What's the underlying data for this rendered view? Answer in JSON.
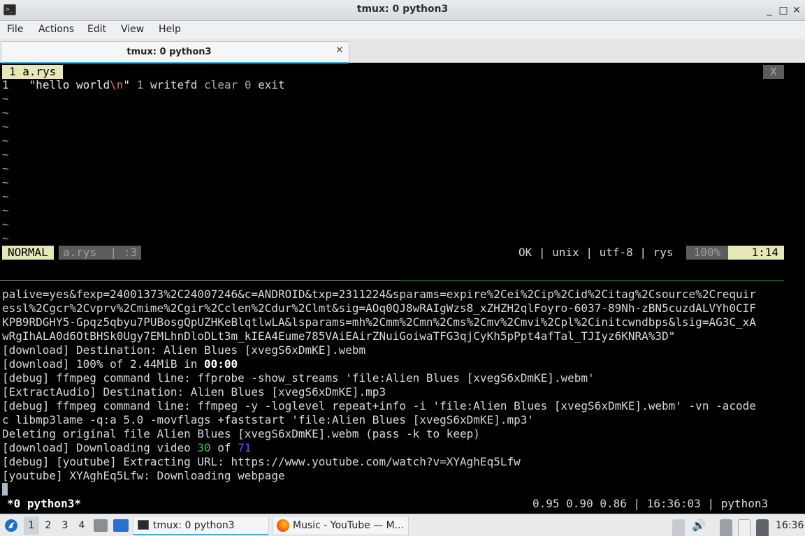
{
  "window": {
    "title": "tmux: 0 python3",
    "controls": {
      "minimize": "_",
      "maximize": "□",
      "close": "✕"
    }
  },
  "menu": [
    "File",
    "Actions",
    "Edit",
    "View",
    "Help"
  ],
  "tab": {
    "label": "tmux: 0 python3",
    "close": "✕"
  },
  "vim": {
    "tabline": {
      "active": "1 a.rys",
      "close": "X"
    },
    "line_number": "1",
    "code": {
      "str_open": "\"hello world",
      "esc": "\\n",
      "str_close": "\"",
      "num1": "1",
      "fn1": "writefd",
      "kw1": "clear",
      "num2": "0",
      "fn2": "exit"
    },
    "tilde": "~",
    "status": {
      "mode": "NORMAL",
      "file": "a.rys  | :3",
      "info": "OK | unix | utf-8 | rys",
      "percent": "100%",
      "position": "1:14"
    }
  },
  "shell_lines": [
    "palive=yes&fexp=24001373%2C24007246&c=ANDROID&txp=2311224&sparams=expire%2Cei%2Cip%2Cid%2Citag%2Csource%2Crequir",
    "essl%2Cgcr%2Cvprv%2Cmime%2Cgir%2Cclen%2Cdur%2Clmt&sig=AOq0QJ8wRAIgWzs8_xZHZH2qlFoyro-6037-89Nh-zBN5cuzdALVYh0CIF",
    "KPB9RDGHY5-Gpqz5qbyu7PUBosgQpUZHKeBlqtlwLA&lsparams=mh%2Cmm%2Cmn%2Cms%2Cmv%2Cmvi%2Cpl%2Cinitcwndbps&lsig=AG3C_xA",
    "wRgIhALA0d6OtBHSk0Ugy7EMLhnDloDLt3m_kIEA4Eume785VAiEAirZNuiGoiwaTFG3qjCyKh5pPpt4afTal_TJIyz6KNRA%3D\"",
    "[download] Destination: Alien Blues [xvegS6xDmKE].webm"
  ],
  "download_line": {
    "prefix": "[download] 100% of 2.44MiB in ",
    "time": "00:00"
  },
  "shell_lines2": [
    "[debug] ffmpeg command line: ffprobe -show_streams 'file:Alien Blues [xvegS6xDmKE].webm'",
    "[ExtractAudio] Destination: Alien Blues [xvegS6xDmKE].mp3",
    "[debug] ffmpeg command line: ffmpeg -y -loglevel repeat+info -i 'file:Alien Blues [xvegS6xDmKE].webm' -vn -acode",
    "c libmp3lame -q:a 5.0 -movflags +faststart 'file:Alien Blues [xvegS6xDmKE].mp3'",
    "Deleting original file Alien Blues [xvegS6xDmKE].webm (pass -k to keep)"
  ],
  "video_line": {
    "prefix": "[download] Downloading video ",
    "current": "30",
    "of": " of ",
    "total": "71"
  },
  "shell_lines3": [
    "[debug] [youtube] Extracting URL: https://www.youtube.com/watch?v=XYAghEq5Lfw",
    "[youtube] XYAghEq5Lfw: Downloading webpage"
  ],
  "tmux": {
    "window": "*0 python3*",
    "right": "0.95 0.90 0.86 | 16:36:03 | python3"
  },
  "taskbar": {
    "desktops": [
      "1",
      "2",
      "3",
      "4"
    ],
    "tasks": [
      "tmux: 0 python3",
      "Music - YouTube — M..."
    ],
    "clock": "16:36"
  }
}
